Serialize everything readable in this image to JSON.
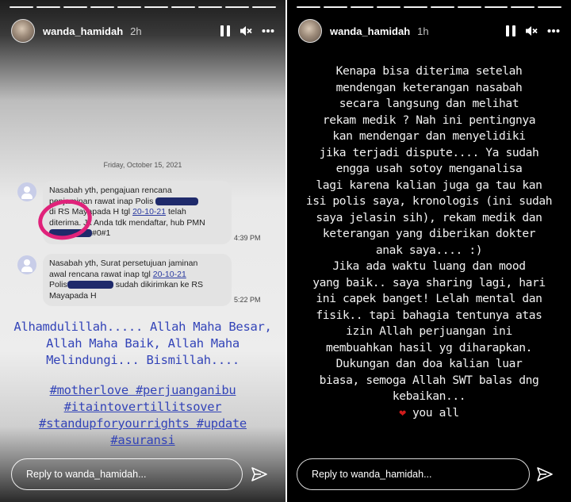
{
  "left_story": {
    "username": "wanda_hamidah",
    "time": "2h",
    "sms": {
      "date": "Friday, October 15, 2021",
      "message1": {
        "line1": "Nasabah yth, pengajuan rencana",
        "line2": "penjaminan rawat inap Polis",
        "line3_pre": "di RS Mayapada H tgl",
        "line3_link": "20-10-21",
        "line3_post": "telah",
        "line4": "diterima. Jk Anda tdk mendaftar, hub PMN",
        "line5": "#0#1",
        "time": "4:39 PM"
      },
      "message2": {
        "line1": "Nasabah yth, Surat persetujuan jaminan",
        "line2_pre": "awal rencana rawat inap tgl",
        "line2_link": "20-10-21",
        "line3_pre": "Polis",
        "line3_post": "sudah dikirimkan ke RS",
        "line4": "Mayapada H",
        "time": "5:22 PM"
      }
    },
    "caption_lines": [
      "Alhamdulillah..... Allah Maha Besar,",
      "Allah Maha Baik, Allah Maha",
      "Melindungi... Bismillah...."
    ],
    "hashtag_lines": [
      "#motherlove #perjuanganibu",
      "#itaintovertillitsover",
      "#standupforyourrights #update",
      "#asuransi"
    ],
    "reply_placeholder": "Reply to wanda_hamidah..."
  },
  "right_story": {
    "username": "wanda_hamidah",
    "time": "1h",
    "text_lines": [
      "Kenapa bisa diterima setelah",
      "mendengan keterangan nasabah",
      "secara langsung dan melihat",
      "rekam medik ? Nah ini pentingnya",
      "kan mendengar dan menyelidiki",
      "jika terjadi dispute....  Ya sudah",
      "engga usah sotoy menganalisa",
      "lagi karena kalian juga ga tau kan",
      "isi polis saya, kronologis  (ini sudah",
      "saya jelasin sih), rekam medik dan",
      "keterangan yang diberikan dokter",
      "anak saya.... :)",
      "Jika ada waktu luang dan mood",
      "yang baik.. saya sharing lagi, hari",
      "ini capek banget! Lelah mental dan",
      "fisik.. tapi bahagia tentunya atas",
      "izin Allah perjuangan ini",
      "membuahkan hasil yg diharapkan.",
      "Dukungan dan doa kalian luar",
      "biasa, semoga Allah SWT balas dng",
      "kebaikan..."
    ],
    "closing_text": "you all",
    "reply_placeholder": "Reply to wanda_hamidah..."
  },
  "colors": {
    "caption_blue": "#3344b8",
    "heart_red": "#d01c1c",
    "circle_pink": "#e0227a",
    "redaction_navy": "#1f2a6b"
  },
  "icons": [
    "pause-icon",
    "mute-icon",
    "more-icon",
    "send-icon",
    "heart-icon"
  ]
}
